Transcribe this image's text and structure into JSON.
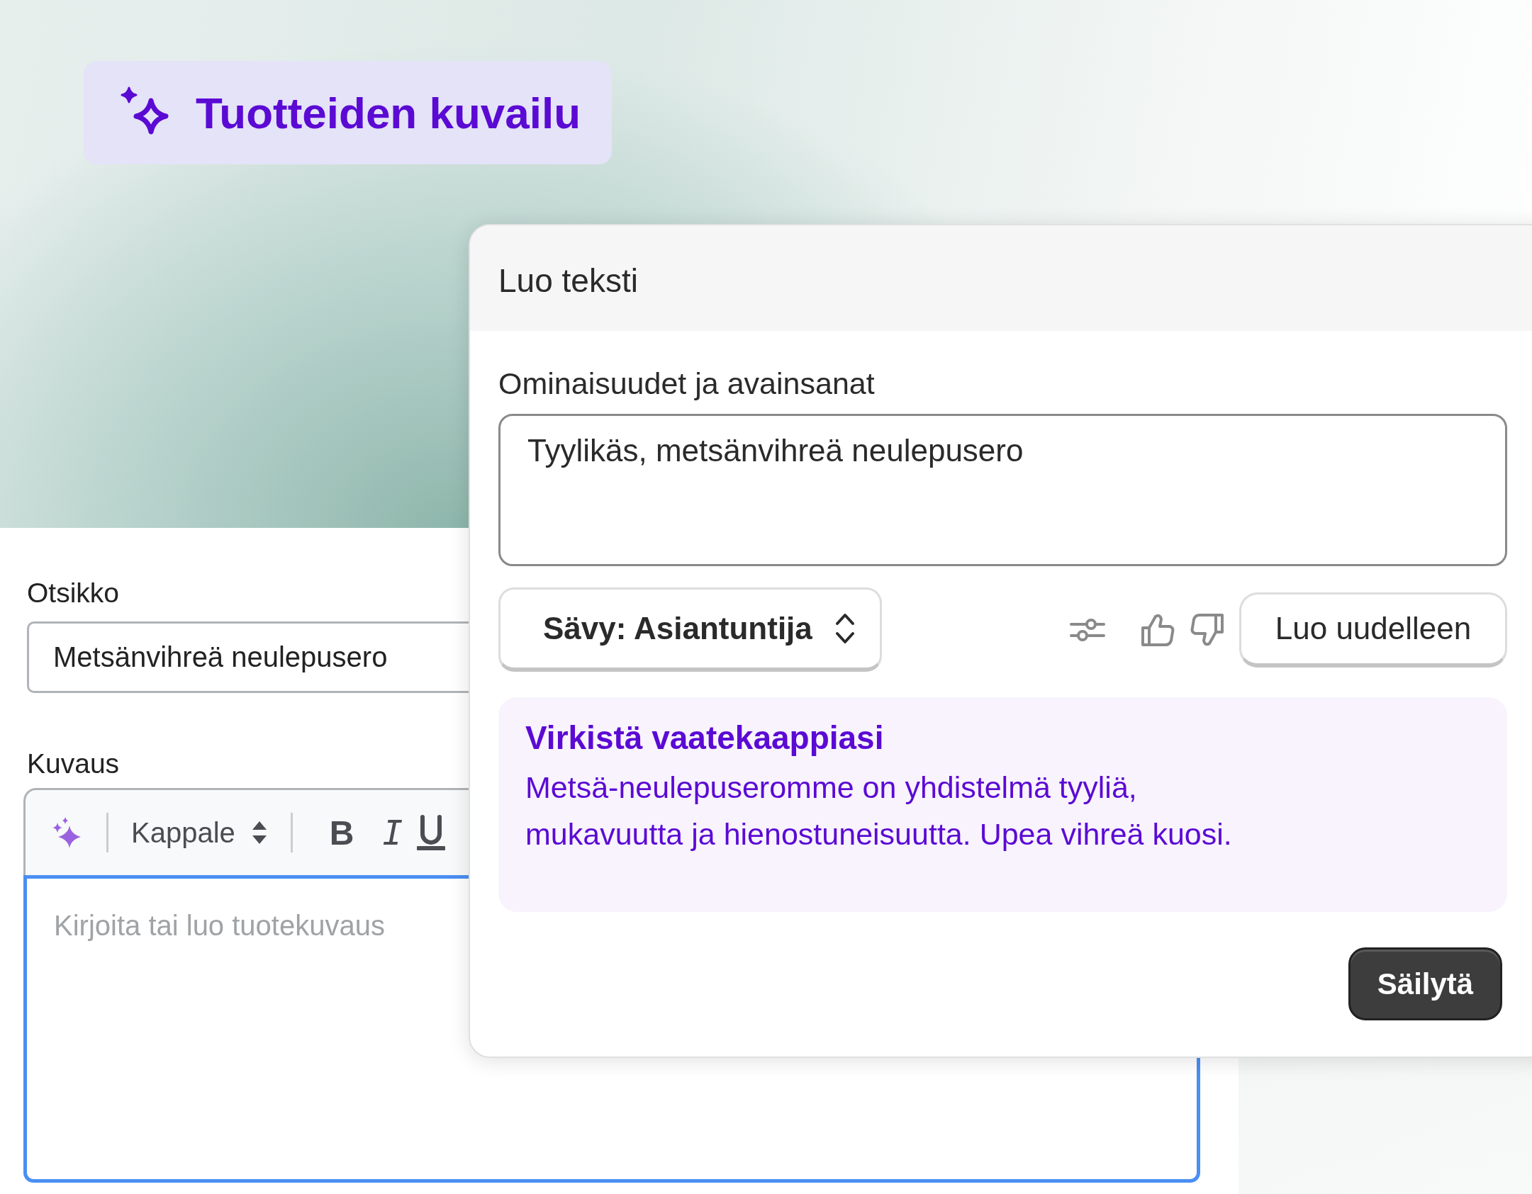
{
  "hero": {
    "badge": {
      "title": "Tuotteiden kuvailu"
    }
  },
  "form": {
    "title_field": {
      "label": "Otsikko",
      "value": "Metsänvihreä neulepusero"
    },
    "description": {
      "label": "Kuvaus",
      "block_style": "Kappale",
      "focused": true,
      "placeholder": "Kirjoita tai luo tuotekuvaus",
      "format_buttons": [
        {
          "kind": "bold",
          "label": "B"
        },
        {
          "kind": "italic",
          "label": "I"
        },
        {
          "kind": "underline"
        }
      ]
    }
  },
  "dialog": {
    "title": "Luo teksti",
    "keywords": {
      "label": "Ominaisuudet ja avainsanat",
      "value": "Tyylikäs, metsänvihreä neulepusero"
    },
    "tone": "Sävy: Asiantuntija",
    "regenerate": "Luo uudelleen",
    "result": {
      "heading": "Virkistä vaatekaappiasi",
      "body": "Metsä-neulepuseromme on yhdistelmä tyyliä, mukavuutta ja hienostuneisuutta. Upea vihreä kuosi."
    },
    "keep": "Säilytä"
  }
}
